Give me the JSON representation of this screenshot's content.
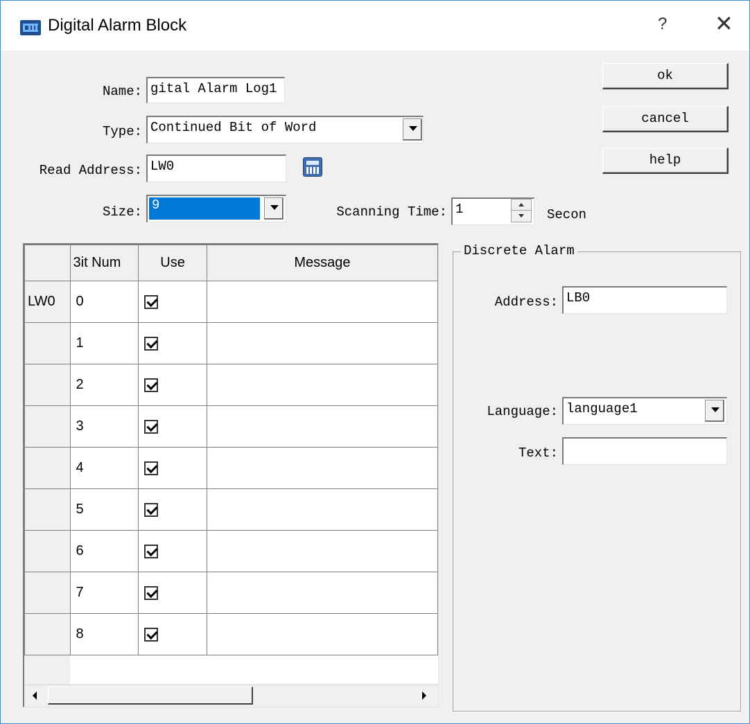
{
  "window": {
    "title": "Digital Alarm Block",
    "help_label": "?",
    "close_label": "✕"
  },
  "form": {
    "name_label": "Name:",
    "name_value": "gital Alarm Log1",
    "type_label": "Type:",
    "type_value": "Continued Bit of Word",
    "read_address_label": "Read Address:",
    "read_address_value": "LW0",
    "size_label": "Size:",
    "size_value": "9",
    "scanning_time_label": "Scanning Time:",
    "scanning_time_value": "1",
    "scanning_time_unit": "Secon"
  },
  "buttons": {
    "ok": "ok",
    "cancel": "cancel",
    "help": "help"
  },
  "grid": {
    "headers": {
      "bit": "3it Num",
      "use": "Use",
      "message": "Message"
    },
    "rows": [
      {
        "row_header": "LW0",
        "bit": "0",
        "use": true,
        "message": ""
      },
      {
        "row_header": "",
        "bit": "1",
        "use": true,
        "message": ""
      },
      {
        "row_header": "",
        "bit": "2",
        "use": true,
        "message": ""
      },
      {
        "row_header": "",
        "bit": "3",
        "use": true,
        "message": ""
      },
      {
        "row_header": "",
        "bit": "4",
        "use": true,
        "message": ""
      },
      {
        "row_header": "",
        "bit": "5",
        "use": true,
        "message": ""
      },
      {
        "row_header": "",
        "bit": "6",
        "use": true,
        "message": ""
      },
      {
        "row_header": "",
        "bit": "7",
        "use": true,
        "message": ""
      },
      {
        "row_header": "",
        "bit": "8",
        "use": true,
        "message": ""
      }
    ]
  },
  "discrete_alarm": {
    "group_title": "Discrete Alarm",
    "address_label": "Address:",
    "address_value": "LB0",
    "language_label": "Language:",
    "language_value": "language1",
    "text_label": "Text:",
    "text_value": ""
  },
  "icons": {
    "app": "hmi-icon",
    "calculator": "calculator-icon",
    "dropdown": "chevron-down-icon",
    "spin_up": "spin-up-icon",
    "spin_down": "spin-down-icon"
  },
  "colors": {
    "selection": "#0078d7",
    "title_bar": "#ffffff",
    "dialog_bg": "#f0f0f0"
  }
}
